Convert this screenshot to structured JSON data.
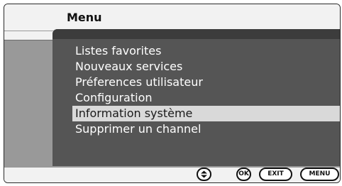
{
  "header": {
    "title": "Menu"
  },
  "menu": {
    "items": [
      {
        "label": "Listes favorites"
      },
      {
        "label": "Nouveaux services"
      },
      {
        "label": "Préferences utilisateur"
      },
      {
        "label": "Configuration"
      },
      {
        "label": "Information système",
        "selected": true
      },
      {
        "label": "Supprimer un channel"
      }
    ]
  },
  "footer": {
    "nav_icon": "up-down-arrows-icon",
    "ok_label": "OK",
    "exit_label": "EXIT",
    "menu_label": "MENU"
  }
}
